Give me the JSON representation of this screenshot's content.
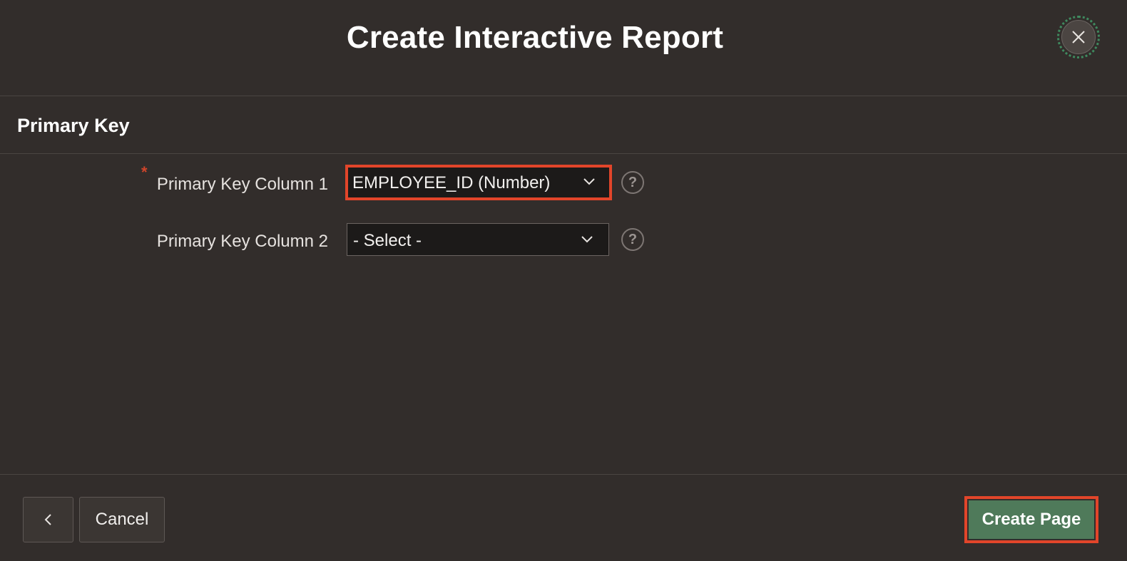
{
  "dialog": {
    "title": "Create Interactive Report",
    "close_icon": "close-icon"
  },
  "section": {
    "title": "Primary Key"
  },
  "fields": [
    {
      "label": "Primary Key Column 1",
      "required_mark": "*",
      "value": "EMPLOYEE_ID (Number)",
      "help": "?",
      "highlighted": true
    },
    {
      "label": "Primary Key Column 2",
      "value": "- Select -",
      "help": "?",
      "highlighted": false
    }
  ],
  "footer": {
    "back_icon": "chevron-left-icon",
    "cancel_label": "Cancel",
    "create_label": "Create Page"
  },
  "colors": {
    "background": "#322d2b",
    "primary_button": "#4f7a5a",
    "highlight": "#e2452a",
    "required": "#d0452b"
  }
}
